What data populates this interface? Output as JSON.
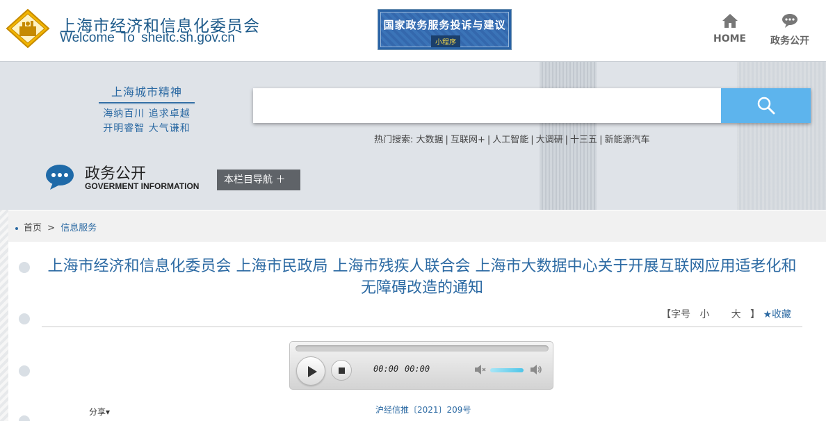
{
  "header": {
    "site_title": "上海市经济和信息化委员会",
    "site_subtitle": "Welcome To sheitc.sh.gov.cn",
    "banner_title": "国家政务服务投诉与建议",
    "banner_tag": "小程序",
    "nav": [
      {
        "label": "HOME",
        "icon": "home-icon"
      },
      {
        "label": "政务公开",
        "icon": "chat-bubble-icon"
      }
    ]
  },
  "hero": {
    "slogan_title": "上海城市精神",
    "slogan_lines": [
      "海纳百川 追求卓越",
      "开明睿智 大气谦和"
    ],
    "search_placeholder": "",
    "hot_search_label": "热门搜索:",
    "hot_terms": [
      "大数据",
      "互联网+",
      "人工智能",
      "大调研",
      "十三五",
      "新能源汽车"
    ],
    "section_title": "政务公开",
    "section_subtitle": "GOVERMENT INFORMATION",
    "column_nav_label": "本栏目导航 ＋"
  },
  "breadcrumb": {
    "home": "首页",
    "separator": ">",
    "current": "信息服务"
  },
  "article": {
    "title": "上海市经济和信息化委员会 上海市民政局 上海市残疾人联合会 上海市大数据中心关于开展互联网应用适老化和无障碍改造的通知",
    "font_size_label": "【字号",
    "font_small": "小",
    "font_large": "大",
    "font_close": "】",
    "favorite": "★收藏",
    "share_label": "分享▾",
    "doc_number": "沪经信推〔2021〕209号"
  },
  "player": {
    "current_time": "00:00",
    "duration": "00:00"
  },
  "colors": {
    "accent_blue": "#2c6aa3",
    "search_button": "#5db4ed",
    "column_nav_bg": "#5f6368"
  }
}
